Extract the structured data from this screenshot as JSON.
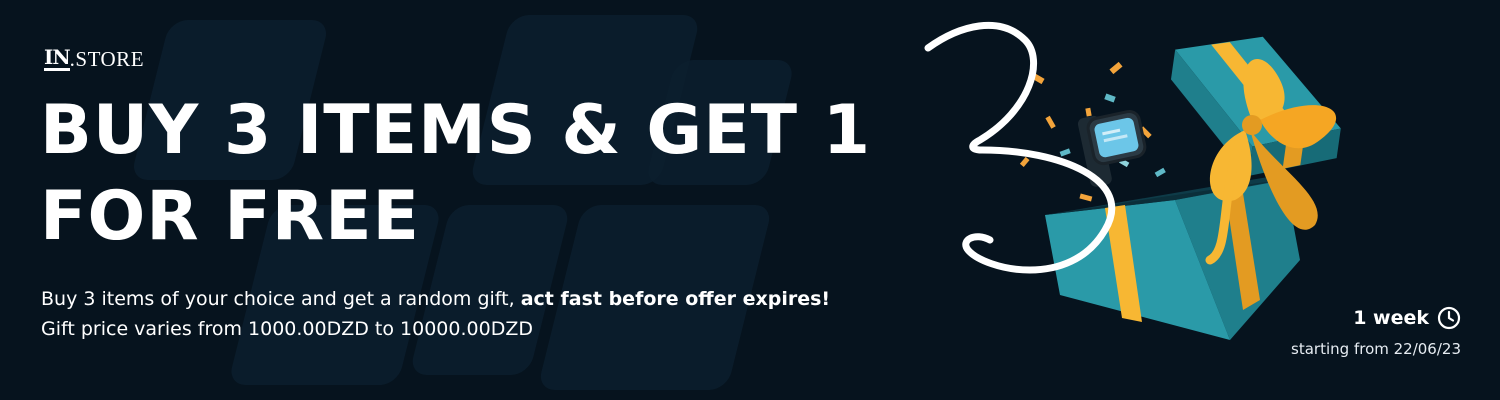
{
  "logo": {
    "mark": "IN",
    "text": ".STORE"
  },
  "headline": {
    "line1": "BUY 3 ITEMS & GET 1",
    "line2": "FOR FREE"
  },
  "description": {
    "line1_plain": "Buy 3 items of your choice and get a random gift, ",
    "line1_bold": "act fast before offer expires!",
    "line2": "Gift price varies from 1000.00DZD to 10000.00DZD"
  },
  "offer": {
    "duration": "1 week",
    "start": "starting from 22/06/23"
  },
  "icons": {
    "clock": "clock-icon",
    "gift": "gift-box-icon",
    "watch": "smartwatch-icon"
  },
  "colors": {
    "background": "#06131e",
    "gift_box": "#2a9aa8",
    "ribbon": "#f7b733",
    "text": "#ffffff"
  }
}
